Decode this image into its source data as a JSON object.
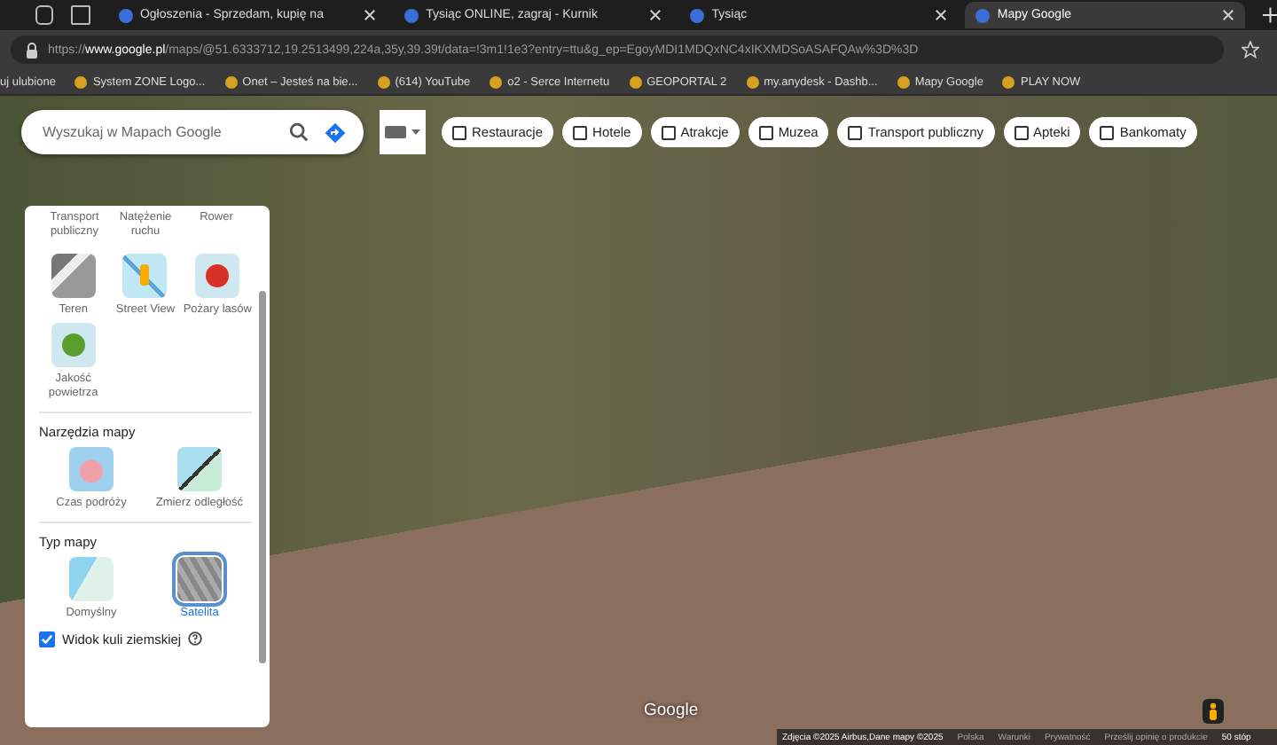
{
  "tabs": [
    {
      "title": "Ogłoszenia - Sprzedam, kupię na",
      "selected": false
    },
    {
      "title": "Tysiąc ONLINE, zagraj - Kurnik",
      "selected": false
    },
    {
      "title": "Tysiąc",
      "selected": false
    },
    {
      "title": "Mapy Google",
      "selected": true
    }
  ],
  "address": {
    "scheme": "https://",
    "host": "www.google.pl",
    "path": "/maps/@51.6333712,19.2513499,224a,35y,39.39t/data=!3m1!1e3?entry=ttu&g_ep=EgoyMDI1MDQxNC4xIKXMDSoASAFQAw%3D%3D"
  },
  "bookmarks": [
    "uj ulubione",
    "System ZONE Logo...",
    "Onet – Jesteś na bie...",
    "(614) YouTube",
    "o2 - Serce Internetu",
    "GEOPORTAL 2",
    "my.anydesk - Dashb...",
    "Mapy Google",
    "PLAY NOW"
  ],
  "search": {
    "placeholder": "Wyszukaj w Mapach Google"
  },
  "chips": [
    "Restauracje",
    "Hotele",
    "Atrakcje",
    "Muzea",
    "Transport publiczny",
    "Apteki",
    "Bankomaty"
  ],
  "layers": {
    "top_labels": [
      "Transport publiczny",
      "Natężenie ruchu",
      "Rower"
    ],
    "details": [
      {
        "label": "Teren",
        "kind": "terrain"
      },
      {
        "label": "Street View",
        "kind": "streetview"
      },
      {
        "label": "Pożary lasów",
        "kind": "fire"
      },
      {
        "label": "Jakość powietrza",
        "kind": "air"
      }
    ],
    "tools_title": "Narzędzia mapy",
    "tools": [
      {
        "label": "Czas podróży",
        "kind": "travel"
      },
      {
        "label": "Zmierz odległość",
        "kind": "measure"
      }
    ],
    "type_title": "Typ mapy",
    "types": [
      {
        "label": "Domyślny",
        "kind": "default",
        "selected": false
      },
      {
        "label": "Satelita",
        "kind": "satellite",
        "selected": true
      }
    ],
    "globe": {
      "label": "Widok kuli ziemskiej",
      "checked": true
    }
  },
  "logo": "Google",
  "footer": [
    "Zdjęcia ©2025 Airbus,Dane mapy ©2025",
    "Polska",
    "Warunki",
    "Prywatność",
    "Prześlij opinię o produkcie",
    "50 stóp"
  ]
}
